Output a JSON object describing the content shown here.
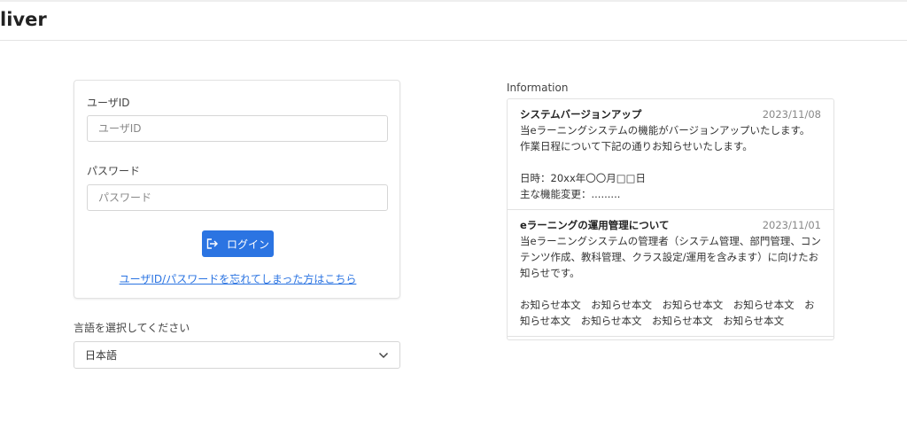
{
  "header": {
    "logo": "liver"
  },
  "login": {
    "userid_label": "ユーザID",
    "userid_placeholder": "ユーザID",
    "userid_value": "",
    "password_label": "パスワード",
    "password_placeholder": "パスワード",
    "password_value": "",
    "login_button": "ログイン",
    "forgot_link": "ユーザID/パスワードを忘れてしまった方はこちら"
  },
  "language": {
    "label": "言語を選択してください",
    "selected": "日本語"
  },
  "information": {
    "label": "Information",
    "items": [
      {
        "title": "システムバージョンアップ",
        "date": "2023/11/08",
        "body": "当eラーニングシステムの機能がバージョンアップいたします。\n作業日程について下記の通りお知らせいたします。\n\n日時：20xx年〇〇月□□日\n主な機能変更：........."
      },
      {
        "title": "eラーニングの運用管理について",
        "date": "2023/11/01",
        "body": "当eラーニングシステムの管理者（システム管理、部門管理、コンテンツ作成、教科管理、クラス設定/運用を含みます）に向けたお知らせです。\n\nお知らせ本文　お知らせ本文　お知らせ本文　お知らせ本文　お知らせ本文　お知らせ本文　お知らせ本文　お知らせ本文"
      }
    ]
  }
}
